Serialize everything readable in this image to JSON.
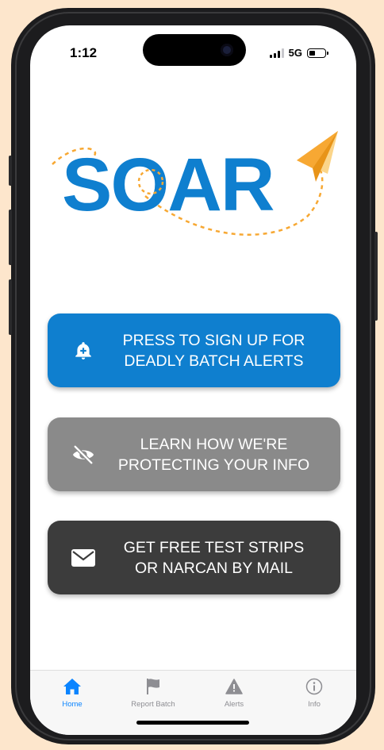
{
  "status_bar": {
    "time": "1:12",
    "network": "5G"
  },
  "logo": {
    "text": "SOAR",
    "brand_blue": "#0f7fcf",
    "accent_orange": "#f7a833"
  },
  "buttons": [
    {
      "icon": "bell-plus-icon",
      "line1": "PRESS TO SIGN UP FOR",
      "line2": "DEADLY BATCH ALERTS",
      "color": "#0f7fcf"
    },
    {
      "icon": "eye-slash-icon",
      "line1": "LEARN HOW WE'RE",
      "line2": "PROTECTING YOUR INFO",
      "color": "#8a8a8a"
    },
    {
      "icon": "envelope-icon",
      "line1": "GET FREE TEST STRIPS",
      "line2": "OR NARCAN BY MAIL",
      "color": "#3c3c3c"
    }
  ],
  "tabs": [
    {
      "label": "Home",
      "icon": "house-icon",
      "active": true
    },
    {
      "label": "Report Batch",
      "icon": "flag-icon",
      "active": false
    },
    {
      "label": "Alerts",
      "icon": "warning-triangle-icon",
      "active": false
    },
    {
      "label": "Info",
      "icon": "info-circle-icon",
      "active": false
    }
  ],
  "colors": {
    "active_tab": "#0a84ff",
    "inactive_tab": "#8e8e93",
    "background": "#fde6cc"
  }
}
